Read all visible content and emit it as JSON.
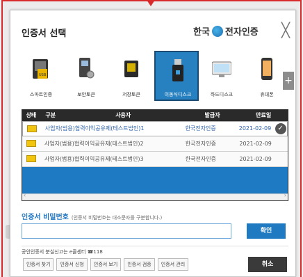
{
  "dialog": {
    "title": "인증서 선택",
    "brand": "한국 전자인증",
    "close": "╳"
  },
  "devices": [
    {
      "label": "스마트인증",
      "icon": "smart-cert-icon"
    },
    {
      "label": "보안토큰",
      "icon": "security-token-icon"
    },
    {
      "label": "저장토큰",
      "icon": "storage-token-icon"
    },
    {
      "label": "이동식디스크",
      "icon": "usb-drive-icon",
      "selected": true
    },
    {
      "label": "하드디스크",
      "icon": "hard-disk-icon"
    },
    {
      "label": "휴대폰",
      "icon": "mobile-phone-icon"
    }
  ],
  "scroll_plus": "+",
  "table": {
    "headers": [
      "상태",
      "구분",
      "사용자",
      "발급자",
      "만료일"
    ],
    "rows": [
      {
        "type": "사업자(범용)",
        "user": "협력이익공유제(테스트법인)1",
        "issuer": "한국전자인증",
        "expiry": "2021-02-09",
        "selected": true
      },
      {
        "type": "사업자(범용)",
        "user": "협력이익공유제(테스트법인)2",
        "issuer": "한국전자인증",
        "expiry": "2021-02-09"
      },
      {
        "type": "사업자(범용)",
        "user": "협력이익공유제(테스트법인)3",
        "issuer": "한국전자인증",
        "expiry": "2021-02-09"
      }
    ],
    "check": "✓",
    "scroll_left": "‹",
    "scroll_right": "›"
  },
  "password": {
    "label": "인증서 비밀번호",
    "hint": "(인증서 비밀번호는 대소문자를 구분합니다.)",
    "value": "",
    "ok": "확인"
  },
  "footer": {
    "lost_text": "공인인증서 분실신고는 e콜센터 ☎118",
    "buttons": [
      "인증서 찾기",
      "인증서 신청",
      "인증서 보기",
      "인증서 검증",
      "인증서 관리"
    ],
    "cancel": "취소"
  }
}
